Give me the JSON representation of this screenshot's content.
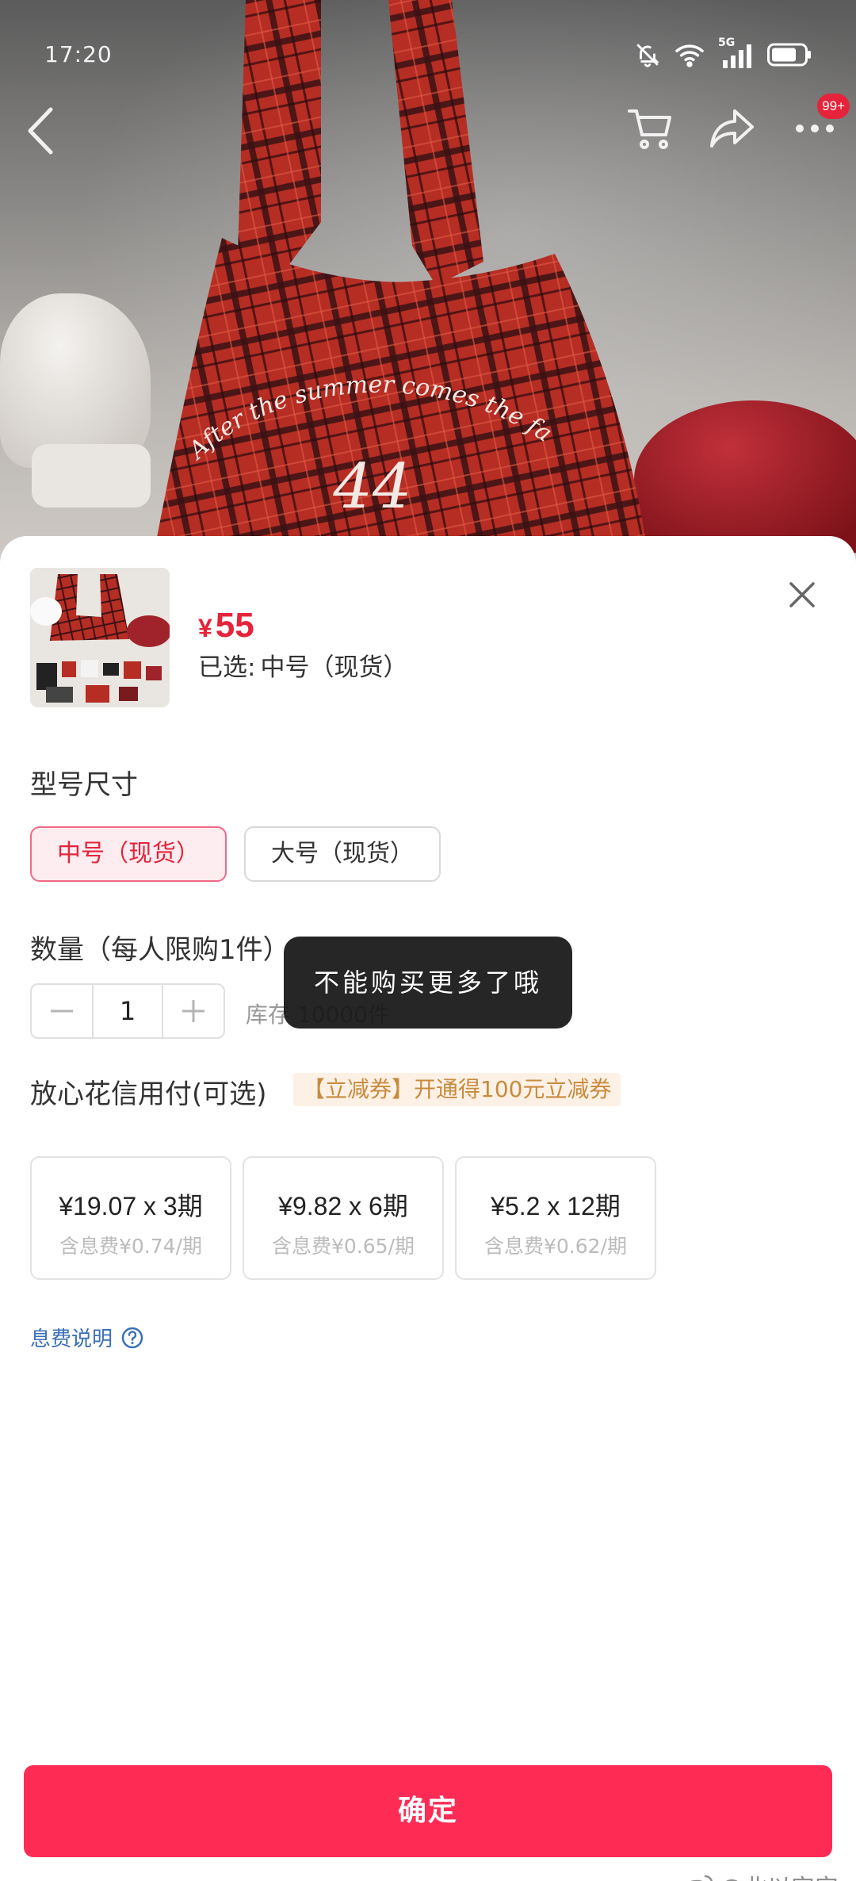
{
  "status_bar": {
    "time": "17:20",
    "network": "5G"
  },
  "header": {
    "badge": "99+"
  },
  "photo": {
    "print_text": "After the summer comes the fall",
    "print_number": "44"
  },
  "sheet": {
    "price_currency": "¥",
    "price_value": "55",
    "selected_label": "已选:",
    "selected_value": "中号（现货）",
    "size_section_title": "型号尺寸",
    "size_options": [
      {
        "label": "中号（现货）",
        "selected": true
      },
      {
        "label": "大号（现货）",
        "selected": false
      }
    ],
    "quantity_title": "数量（每人限购1件）",
    "quantity_value": "1",
    "stock_text": "库存 10000件",
    "toast_text": "不能购买更多了哦",
    "credit_title": "放心花信用付(可选)",
    "coupon_text": "【立减券】开通得100元立减券",
    "installments": [
      {
        "main": "¥19.07 x 3期",
        "sub": "含息费¥0.74/期"
      },
      {
        "main": "¥9.82 x 6期",
        "sub": "含息费¥0.65/期"
      },
      {
        "main": "¥5.2 x 12期",
        "sub": "含息费¥0.62/期"
      }
    ],
    "fee_link": "息费说明",
    "confirm_label": "确定"
  },
  "watermark": "@北以安安",
  "colors": {
    "accent": "#fe2c55",
    "price": "#e5243b",
    "link": "#3a6fb8",
    "coupon_bg": "#fdf1e6",
    "coupon_text": "#c98a3d"
  }
}
